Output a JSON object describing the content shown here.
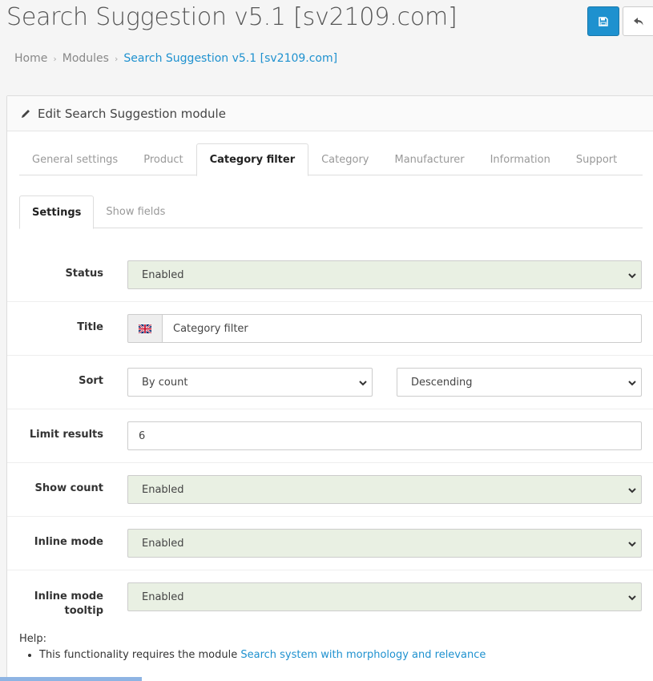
{
  "header": {
    "title": "Search Suggestion v5.1 [sv2109.com]",
    "save_icon": "save-icon",
    "back_icon": "reply-icon"
  },
  "breadcrumb": [
    "Home",
    "Modules",
    "Search Suggestion v5.1 [sv2109.com]"
  ],
  "panel": {
    "title": "Edit Search Suggestion module",
    "icon": "pencil-icon"
  },
  "tabs": [
    {
      "label": "General settings",
      "active": false
    },
    {
      "label": "Product",
      "active": false
    },
    {
      "label": "Category filter",
      "active": true
    },
    {
      "label": "Category",
      "active": false
    },
    {
      "label": "Manufacturer",
      "active": false
    },
    {
      "label": "Information",
      "active": false
    },
    {
      "label": "Support",
      "active": false
    }
  ],
  "subtabs": [
    {
      "label": "Settings",
      "active": true
    },
    {
      "label": "Show fields",
      "active": false
    }
  ],
  "form": {
    "status": {
      "label": "Status",
      "value": "Enabled"
    },
    "title": {
      "label": "Title",
      "value": "Category filter",
      "flag": "uk-flag-icon"
    },
    "sort": {
      "label": "Sort",
      "value": "By count",
      "order": "Descending"
    },
    "limit": {
      "label": "Limit results",
      "value": "6"
    },
    "show_count": {
      "label": "Show count",
      "value": "Enabled"
    },
    "inline_mode": {
      "label": "Inline mode",
      "value": "Enabled"
    },
    "inline_tooltip": {
      "label_line1": "Inline mode",
      "label_line2": "tooltip",
      "value": "Enabled"
    }
  },
  "help": {
    "title": "Help:",
    "item_text": "This functionality requires the module ",
    "item_link": "Search system with morphology and relevance"
  },
  "colors": {
    "primary": "#1e91cf",
    "enabled_bg": "#e9f0e3"
  }
}
